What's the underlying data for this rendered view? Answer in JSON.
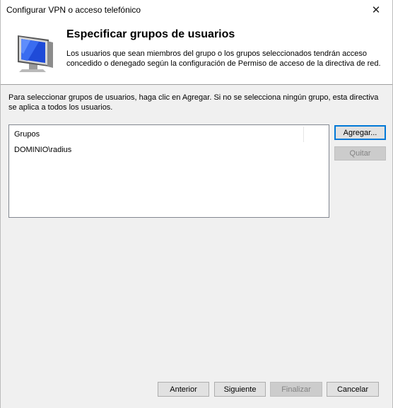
{
  "window": {
    "title": "Configurar VPN o acceso telefónico",
    "close_glyph": "✕"
  },
  "header": {
    "heading": "Especificar grupos de usuarios",
    "description": "Los usuarios que sean miembros del grupo o los grupos seleccionados tendrán acceso concedido o denegado según la configuración de Permiso de acceso de la directiva de red.",
    "icon": "monitor-icon"
  },
  "instructions": "Para seleccionar grupos de usuarios, haga clic en Agregar. Si no se selecciona ningún grupo, esta directiva se aplica a todos los usuarios.",
  "groups_list": {
    "column_header": "Grupos",
    "rows": [
      "DOMINIO\\radius"
    ]
  },
  "side_buttons": {
    "add": "Agregar...",
    "remove": "Quitar"
  },
  "footer_buttons": {
    "back": "Anterior",
    "next": "Siguiente",
    "finish": "Finalizar",
    "cancel": "Cancelar"
  },
  "colors": {
    "accent": "#0078d7",
    "window_bg": "#f0f0f0",
    "header_bg": "#ffffff"
  }
}
